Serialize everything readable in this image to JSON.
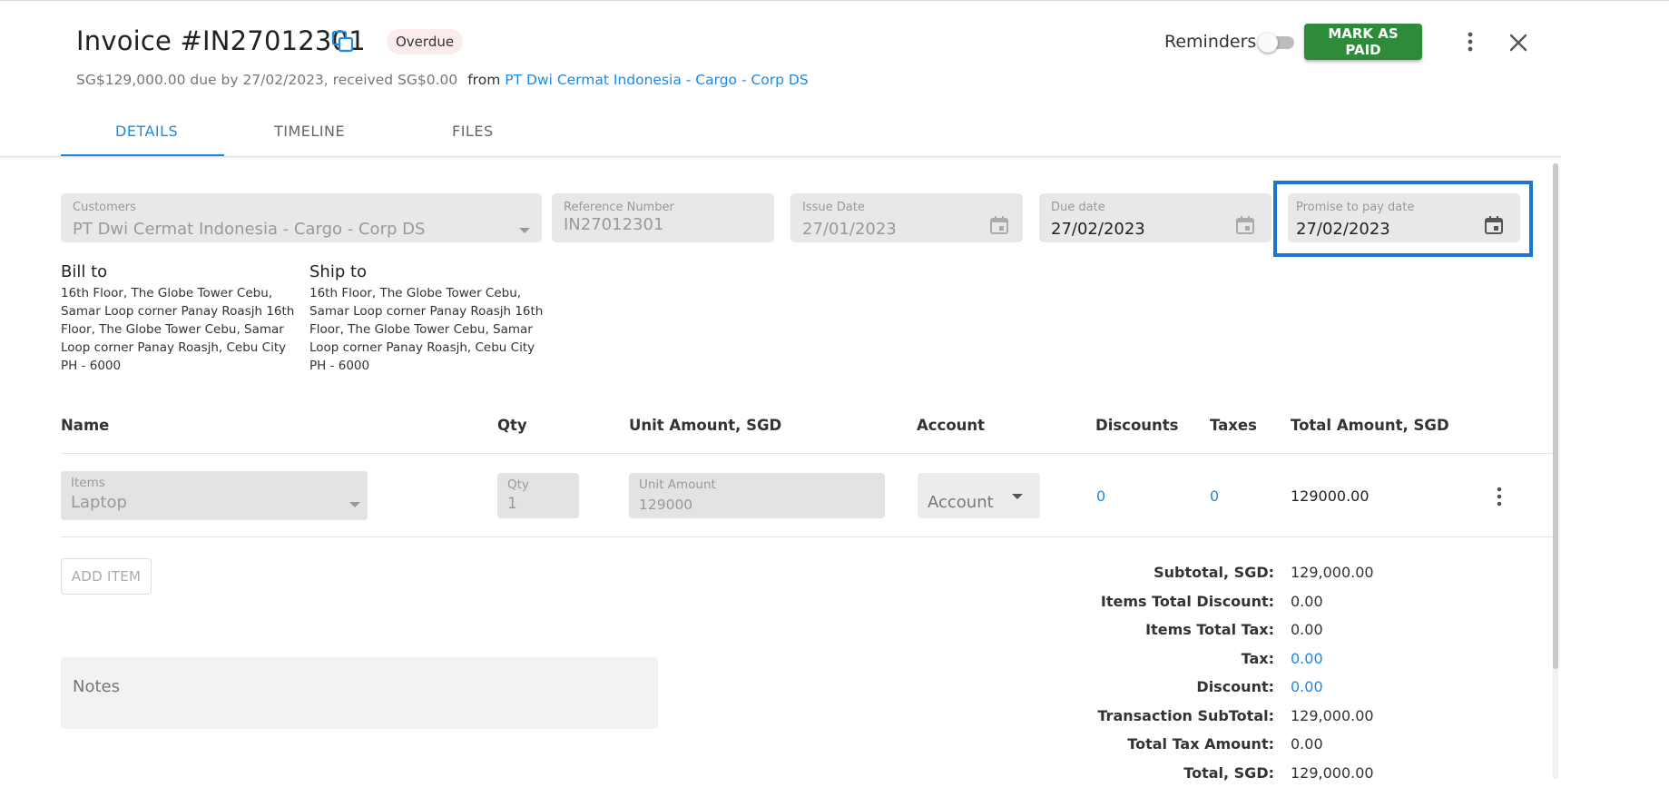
{
  "header": {
    "invoice_title": "Invoice #IN27012301",
    "status_badge": "Overdue",
    "summary_text": "SG$129,000.00 due by 27/02/2023, received SG$0.00",
    "from_label": "from",
    "from_link": "PT Dwi Cermat Indonesia - Cargo - Corp DS",
    "reminders_label": "Reminders",
    "reminders_enabled": false,
    "mark_paid_label": "MARK AS PAID"
  },
  "tabs": [
    {
      "label": "DETAILS",
      "active": true
    },
    {
      "label": "TIMELINE",
      "active": false
    },
    {
      "label": "FILES",
      "active": false
    }
  ],
  "fields": {
    "customers": {
      "label": "Customers",
      "value": "PT Dwi Cermat Indonesia - Cargo - Corp DS"
    },
    "reference": {
      "label": "Reference Number",
      "value": "IN27012301"
    },
    "issue_date": {
      "label": "Issue Date",
      "value": "27/01/2023"
    },
    "due_date": {
      "label": "Due date",
      "value": "27/02/2023"
    },
    "promise_date": {
      "label": "Promise to pay date",
      "value": "27/02/2023"
    }
  },
  "bill_to": {
    "title": "Bill to",
    "address": "16th Floor, The Globe Tower Cebu, Samar Loop corner Panay Roasjh 16th Floor, The Globe Tower Cebu, Samar Loop corner Panay Roasjh, Cebu City PH - 6000"
  },
  "ship_to": {
    "title": "Ship to",
    "address": "16th Floor, The Globe Tower Cebu, Samar Loop corner Panay Roasjh 16th Floor, The Globe Tower Cebu, Samar Loop corner Panay Roasjh, Cebu City PH - 6000"
  },
  "table": {
    "columns": [
      "Name",
      "Qty",
      "Unit Amount, SGD",
      "Account",
      "Discounts",
      "Taxes",
      "Total Amount, SGD"
    ],
    "row": {
      "items_label": "Items",
      "items_value": "Laptop",
      "qty_label": "Qty",
      "qty_value": "1",
      "unit_label": "Unit Amount",
      "unit_value": "129000",
      "account_placeholder": "Account",
      "discounts": "0",
      "taxes": "0",
      "total": "129000.00"
    },
    "add_item_label": "ADD ITEM"
  },
  "notes_placeholder": "Notes",
  "totals": [
    {
      "label": "Subtotal, SGD:",
      "value": "129,000.00",
      "link": false
    },
    {
      "label": "Items Total Discount:",
      "value": "0.00",
      "link": false
    },
    {
      "label": "Items Total Tax:",
      "value": "0.00",
      "link": false
    },
    {
      "label": "Tax:",
      "value": "0.00",
      "link": true
    },
    {
      "label": "Discount:",
      "value": "0.00",
      "link": true
    },
    {
      "label": "Transaction SubTotal:",
      "value": "129,000.00",
      "link": false
    },
    {
      "label": "Total Tax Amount:",
      "value": "0.00",
      "link": false
    },
    {
      "label": "Total, SGD:",
      "value": "129,000.00",
      "link": false
    }
  ],
  "colors": {
    "accent": "#1e88e5",
    "primary_button": "#2e8b3a",
    "badge_bg": "#fdecec",
    "focus_border": "#1976d2"
  }
}
